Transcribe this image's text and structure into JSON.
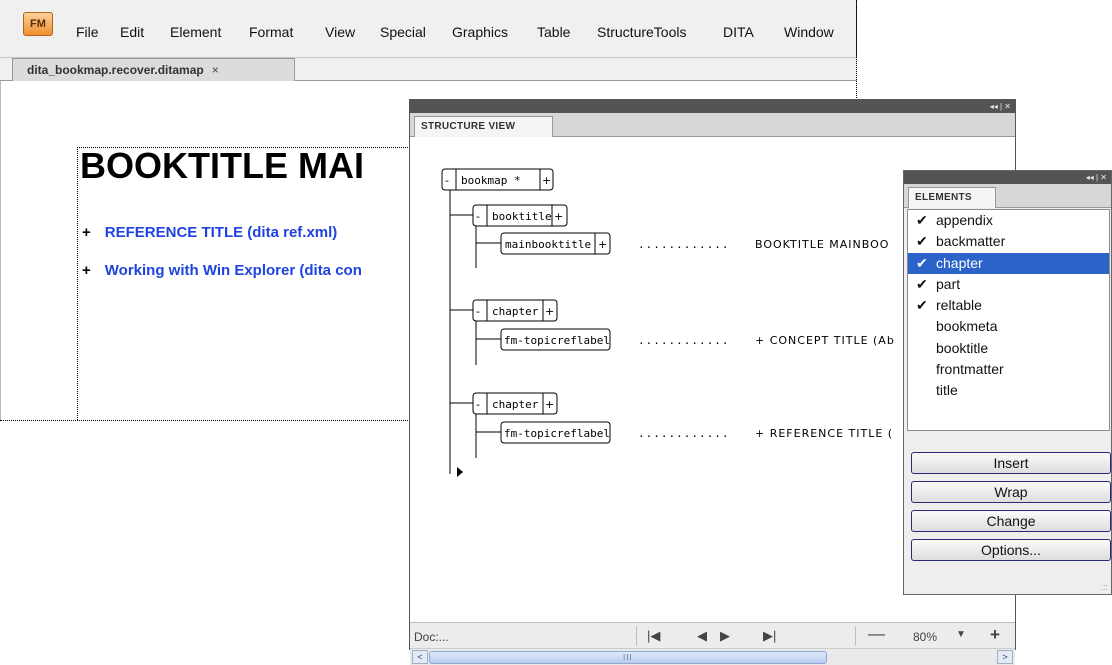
{
  "app": {
    "logo": "FM",
    "menu": [
      "File",
      "Edit",
      "Element",
      "Format",
      "View",
      "Special",
      "Graphics",
      "Table",
      "StructureTools",
      "DITA",
      "Window"
    ],
    "document_tab": {
      "label": "dita_bookmap.recover.ditamap",
      "close": "×"
    }
  },
  "document": {
    "title": "BOOKTITLE MAI",
    "refs": [
      {
        "plus": "+",
        "text": "REFERENCE TITLE (dita ref.xml)"
      },
      {
        "plus": "+",
        "text": "Working with Win Explorer (dita con"
      }
    ]
  },
  "structure_view": {
    "tab_label": "STRUCTURE VIEW",
    "controls": "◂◂ | ✕",
    "nodes": {
      "bookmap": "bookmap *",
      "booktitle": "booktitle",
      "mainbooktitle": "mainbooktitle",
      "chapter1": "chapter",
      "topicref1": "fm-topicreflabel",
      "chapter2": "chapter",
      "topicref2": "fm-topicreflabel"
    },
    "leader": "............",
    "contents": {
      "mainbooktitle": "BOOKTITLE MAINBOO",
      "topicref1": "+ CONCEPT TITLE (Ab",
      "topicref2": "+ REFERENCE TITLE ("
    },
    "collapse_symbol": "-",
    "expand_symbol": "+",
    "status": {
      "doc_label": "Doc:...",
      "zoom": "80%",
      "zoom_dropdown": "▼",
      "zoom_minus": "—",
      "zoom_plus": "+",
      "first": "|◀",
      "prev": "◀",
      "next": "▶",
      "last": "▶|"
    },
    "scroll": {
      "left": "<",
      "right": ">",
      "grip": "III"
    }
  },
  "elements_panel": {
    "tab_label": "ELEMENTS",
    "controls": "◂◂ | ✕",
    "items": [
      {
        "label": "appendix",
        "checked": "✔"
      },
      {
        "label": "backmatter",
        "checked": "✔"
      },
      {
        "label": "chapter",
        "checked": "✔",
        "selected": true
      },
      {
        "label": "part",
        "checked": "✔"
      },
      {
        "label": "reltable",
        "checked": "✔"
      },
      {
        "label": "bookmeta",
        "checked": ""
      },
      {
        "label": "booktitle",
        "checked": ""
      },
      {
        "label": "frontmatter",
        "checked": ""
      },
      {
        "label": "title",
        "checked": ""
      }
    ],
    "buttons": {
      "insert": "Insert",
      "wrap": "Wrap",
      "change": "Change",
      "options": "Options..."
    },
    "resize_grip": ".::"
  },
  "colors": {
    "link_blue": "#1f43e0",
    "selection_blue": "#2b63c9",
    "panel_titlebar": "#545454"
  }
}
